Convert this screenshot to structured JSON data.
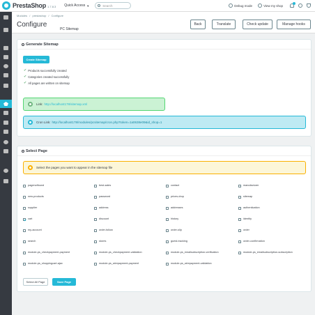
{
  "header": {
    "brand": "PrestaShop",
    "version": "1.7.8.3",
    "quick_access": "Quick Access",
    "search_placeholder": "Search",
    "debug_mode": "Debug mode",
    "view_shop": "View my shop"
  },
  "breadcrumb": [
    "Modules",
    "/",
    "prestashop",
    "/",
    "Configure"
  ],
  "page": {
    "title": "Configure",
    "subtitle": "PC Sitemap",
    "toolbar": [
      "Back",
      "Translate",
      "Check update",
      "Manage hooks"
    ]
  },
  "generate": {
    "heading": "Generate Sitemap",
    "button": "Create Sitemap",
    "status": [
      "Products successfully created",
      "Categories created successfully",
      "All pages are written on sitemap"
    ],
    "link_label": "Link:",
    "link_url": "http://localhost178/sitemap.xml",
    "cron_label": "Cron Link:",
    "cron_url": "http://localhost178/modules/pcsitemap/cron.php?token=1a0638e09&id_shop=1"
  },
  "select": {
    "heading": "Select Page",
    "notice": "Select the pages you want to appear in the sitemap file",
    "pages": [
      {
        "label": "pagenotfound",
        "checked": false
      },
      {
        "label": "best-sales",
        "checked": false
      },
      {
        "label": "contact",
        "checked": false
      },
      {
        "label": "manufacturer",
        "checked": false
      },
      {
        "label": "new-products",
        "checked": false
      },
      {
        "label": "password",
        "checked": false
      },
      {
        "label": "prices-drop",
        "checked": false
      },
      {
        "label": "sitemap",
        "checked": false
      },
      {
        "label": "supplier",
        "checked": false
      },
      {
        "label": "address",
        "checked": false
      },
      {
        "label": "addresses",
        "checked": false
      },
      {
        "label": "authentication",
        "checked": false
      },
      {
        "label": "cart",
        "checked": true
      },
      {
        "label": "discount",
        "checked": false
      },
      {
        "label": "history",
        "checked": false
      },
      {
        "label": "identity",
        "checked": false
      },
      {
        "label": "my-account",
        "checked": false
      },
      {
        "label": "order-follow",
        "checked": false
      },
      {
        "label": "order-slip",
        "checked": false
      },
      {
        "label": "order",
        "checked": false
      },
      {
        "label": "search",
        "checked": false
      },
      {
        "label": "stores",
        "checked": false
      },
      {
        "label": "guest-tracking",
        "checked": false
      },
      {
        "label": "order-confirmation",
        "checked": false
      },
      {
        "label": "module-ps_checkpayment-payment",
        "checked": false
      },
      {
        "label": "module-ps_checkpayment-validation",
        "checked": false
      },
      {
        "label": "module-ps_emailsubscription-verification",
        "checked": false
      },
      {
        "label": "module-ps_emailsubscription-subscription",
        "checked": false
      },
      {
        "label": "module-ps_shoppingcart-ajax",
        "checked": false
      },
      {
        "label": "module-ps_wirepayment-payment",
        "checked": false
      },
      {
        "label": "module-ps_wirepayment-validation",
        "checked": false
      }
    ],
    "select_all": "Select All Page",
    "save": "Save Page"
  },
  "colors": {
    "accent": "#25b9d7",
    "sidebar": "#363a41",
    "success_bg": "#cbf2d4",
    "info_bg": "#beeaf3",
    "warning_bg": "#fcf6d8"
  }
}
